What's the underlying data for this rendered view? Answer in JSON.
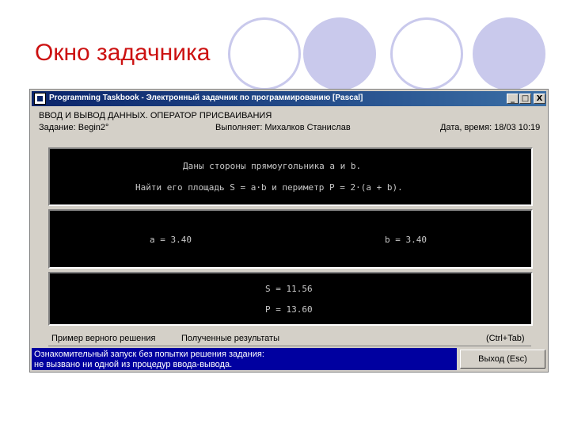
{
  "slide": {
    "title": "Окно задачника"
  },
  "window": {
    "title": "Programming Taskbook - Электронный задачник по программированию [Pascal]",
    "buttons": {
      "minimize": "_",
      "maximize": "□",
      "close": "X"
    }
  },
  "info": {
    "topic": "ВВОД И ВЫВОД ДАННЫХ. ОПЕРАТОР ПРИСВАИВАНИЯ",
    "task": "Задание: Begin2°",
    "performer": "Выполняет: Михалков Станислав",
    "datetime": "Дата, время: 18/03 10:19"
  },
  "panels": {
    "task_text": {
      "line1": "Даны стороны прямоугольника a и b.",
      "line2": "Найти его площадь S = a·b и периметр P = 2·(a + b)."
    },
    "input": {
      "a": "a = 3.40",
      "b": "b = 3.40"
    },
    "output": {
      "s": "S = 11.56",
      "p": "P = 13.60"
    }
  },
  "tabs": {
    "example": "Пример верного решения",
    "results": "Полученные результаты",
    "shortcut": "(Ctrl+Tab)"
  },
  "status": {
    "line1": "Ознакомительный запуск без попытки решения задания:",
    "line2": "не вызвано ни одной из процедур ввода-вывода."
  },
  "exit_button": {
    "label": "Выход (Esc)"
  },
  "colors": {
    "accent_circle": "#c9c9ec",
    "title_red": "#cc1111",
    "status_blue": "#0000a0"
  }
}
